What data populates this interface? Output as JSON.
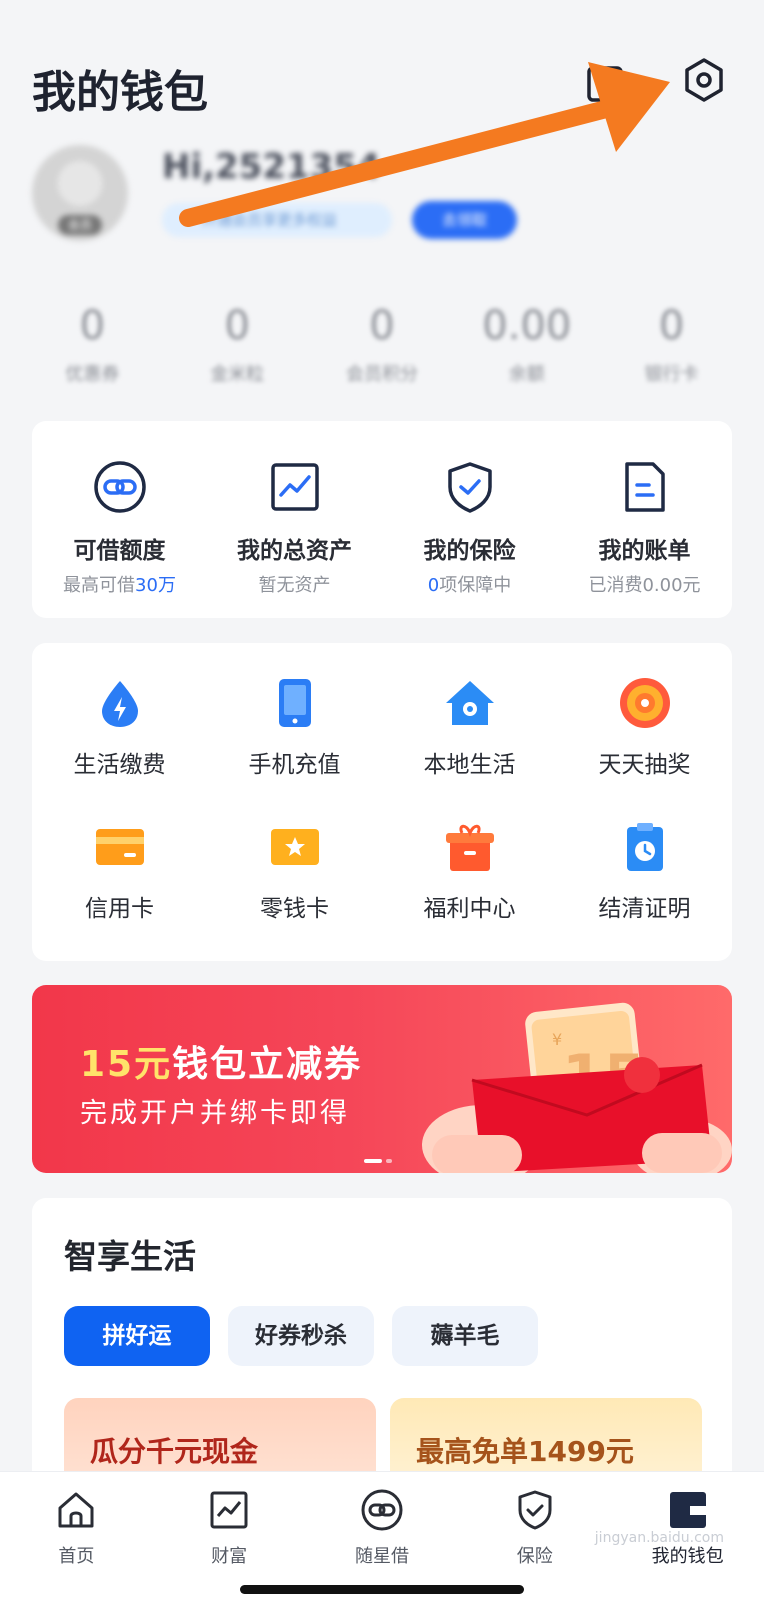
{
  "header": {
    "title": "我的钱包",
    "message_icon": "message-icon",
    "settings_icon": "settings-hexagon-icon"
  },
  "profile": {
    "greeting": "Hi,2521354",
    "member_pill": "开通会员享更多权益",
    "action_pill": "去领取",
    "avatar_tag": "会员"
  },
  "stats": [
    {
      "value": "0",
      "label": "优惠券"
    },
    {
      "value": "0",
      "label": "金米粒"
    },
    {
      "value": "0",
      "label": "会员积分"
    },
    {
      "value": "0.00",
      "label": "余额"
    },
    {
      "value": "0",
      "label": "银行卡"
    }
  ],
  "finance": [
    {
      "title": "可借额度",
      "sub_prefix": "最高可借",
      "sub_highlight": "30万",
      "sub_suffix": "",
      "icon": "credit-link-icon"
    },
    {
      "title": "我的总资产",
      "sub_prefix": "暂无资产",
      "sub_highlight": "",
      "sub_suffix": "",
      "icon": "assets-chart-icon"
    },
    {
      "title": "我的保险",
      "sub_prefix": "",
      "sub_highlight": "0",
      "sub_suffix": "项保障中",
      "icon": "insurance-shield-icon"
    },
    {
      "title": "我的账单",
      "sub_prefix": "已消费0.00元",
      "sub_highlight": "",
      "sub_suffix": "",
      "icon": "bill-document-icon"
    }
  ],
  "services": [
    {
      "label": "生活缴费",
      "icon": "water-drop-icon"
    },
    {
      "label": "手机充值",
      "icon": "phone-icon"
    },
    {
      "label": "本地生活",
      "icon": "home-location-icon"
    },
    {
      "label": "天天抽奖",
      "icon": "lottery-wheel-icon"
    },
    {
      "label": "信用卡",
      "icon": "credit-card-icon"
    },
    {
      "label": "零钱卡",
      "icon": "star-card-icon"
    },
    {
      "label": "福利中心",
      "icon": "gift-box-icon"
    },
    {
      "label": "结清证明",
      "icon": "clipboard-clock-icon"
    }
  ],
  "banner": {
    "title_highlight": "15元",
    "title_rest": "钱包立减券",
    "subtitle": "完成开户并绑卡即得",
    "coupon_value": "15",
    "currency": "¥"
  },
  "life": {
    "title": "智享生活",
    "tabs": [
      "拼好运",
      "好券秒杀",
      "薅羊毛"
    ],
    "active_tab": 0,
    "promo_a": "瓜分千元现金",
    "promo_b": "最高免单1499元"
  },
  "nav": [
    {
      "label": "首页",
      "icon": "home-icon"
    },
    {
      "label": "财富",
      "icon": "wealth-chart-icon"
    },
    {
      "label": "随星借",
      "icon": "loan-link-icon"
    },
    {
      "label": "保险",
      "icon": "shield-check-icon"
    },
    {
      "label": "我的钱包",
      "icon": "wallet-icon"
    }
  ],
  "active_nav": 4,
  "watermark": "jingyan.baidu.com",
  "colors": {
    "primary_blue": "#2b6df5",
    "arrow_orange": "#f47a20",
    "banner_red": "#f2374a"
  }
}
